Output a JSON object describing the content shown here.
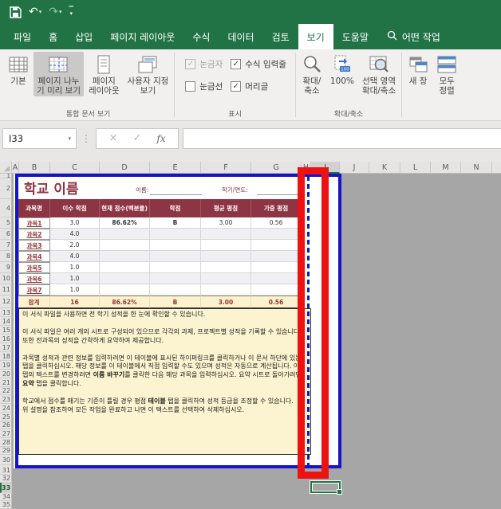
{
  "qat": {
    "items": [
      "save",
      "undo",
      "redo",
      "customize-quick-access-toolbar"
    ]
  },
  "tabs": {
    "items": [
      "파일",
      "홈",
      "삽입",
      "페이지 레이아웃",
      "수식",
      "데이터",
      "검토",
      "보기",
      "도움말"
    ],
    "selected": "보기",
    "search": "어떤 작업"
  },
  "ribbon": {
    "views_group": {
      "label": "통합 문서 보기",
      "buttons": [
        {
          "label1": "기본",
          "label2": ""
        },
        {
          "label1": "페이지 나누",
          "label2": "기 미리 보기"
        },
        {
          "label1": "페이지",
          "label2": "레이아웃"
        },
        {
          "label1": "사용자 지정",
          "label2": "보기"
        }
      ]
    },
    "show_group": {
      "label": "표시",
      "checkboxes": [
        {
          "label": "눈금자"
        },
        {
          "label": "수식 입력줄"
        },
        {
          "label": "눈금선"
        },
        {
          "label": "머리글"
        }
      ]
    },
    "zoom_group": {
      "label": "확대/축소",
      "buttons": [
        {
          "label1": "확대/",
          "label2": "축소"
        },
        {
          "label1": "100%",
          "label2": ""
        },
        {
          "label1": "선택 영역",
          "label2": "확대/축소"
        }
      ]
    },
    "window_group": {
      "buttons": [
        {
          "label1": "새 창",
          "label2": ""
        },
        {
          "label1": "모두",
          "label2": "정렬"
        }
      ]
    }
  },
  "formula_bar": {
    "name_box": "I33",
    "cancel": "×",
    "enter": "✓",
    "fx": "fx"
  },
  "sheet": {
    "columns": [
      "A",
      "B",
      "C",
      "D",
      "E",
      "F",
      "G",
      "H",
      "I",
      "J",
      "K",
      "L",
      "M",
      "N"
    ],
    "rows": [
      "1",
      "2",
      "4",
      "5",
      "6",
      "7",
      "8",
      "9",
      "10",
      "11",
      "12",
      "13",
      "14",
      "15",
      "16",
      "17",
      "18",
      "19",
      "20",
      "21",
      "22",
      "23",
      "24",
      "25",
      "26",
      "27",
      "28",
      "29",
      "30",
      "31",
      "32",
      "33",
      "34",
      "35"
    ],
    "title": "학교 이름",
    "name_label": "이름:",
    "term_label": "학기/연도:",
    "table": {
      "headers": [
        "과목명",
        "이수 학점",
        "현재 점수(백분율)",
        "학점",
        "평균 평점",
        "가중 평점"
      ],
      "rows": [
        {
          "subject": "과목1",
          "credit": "3.0",
          "score": "86.62%",
          "grade": "B",
          "avg": "3.00",
          "weighted": "0.56"
        },
        {
          "subject": "과목2",
          "credit": "4.0",
          "score": "",
          "grade": "",
          "avg": "",
          "weighted": ""
        },
        {
          "subject": "과목3",
          "credit": "2.0",
          "score": "",
          "grade": "",
          "avg": "",
          "weighted": ""
        },
        {
          "subject": "과목4",
          "credit": "4.0",
          "score": "",
          "grade": "",
          "avg": "",
          "weighted": ""
        },
        {
          "subject": "과목5",
          "credit": "1.0",
          "score": "",
          "grade": "",
          "avg": "",
          "weighted": ""
        },
        {
          "subject": "과목6",
          "credit": "1.0",
          "score": "",
          "grade": "",
          "avg": "",
          "weighted": ""
        },
        {
          "subject": "과목7",
          "credit": "1.0",
          "score": "",
          "grade": "",
          "avg": "",
          "weighted": ""
        }
      ],
      "total": {
        "label": "합계",
        "credit": "16",
        "score": "86.62%",
        "grade": "B",
        "avg": "3.00",
        "weighted": "0.56"
      }
    },
    "instructions": {
      "p1": "이 서식 파일을 사용하면 전 학기 성적을 한 눈에 확인할 수 있습니다.",
      "p2": "이 서식 파일은 여러 개의 시트로 구성되어 있으므로 각각의 과제, 프로젝트별 성적을 기록할 수 있습니다.  또한 전과목의 성적을 간략하게 요약하여 제공합니다.",
      "p3a": "과목별 성적과 관련 정보를 입력하려면 이 테이블에 표시된 하이퍼링크를 클릭하거나 이 문서 하단에 있는 탭을 클릭하십시오. 해당 정보를 이 테이블에서 직접 입력할 수도 있으며 성적은 자동으로 계산됩니다. 아래 탭의 텍스트를 변경하려면 ",
      "p3b": "이름 바꾸기",
      "p3c": "를 클릭한 다음 해당 과목을 입력하십시오. 요약 시트로 돌아가려면 ",
      "p3d": "요약",
      "p3e": " 탭을 클릭합니다.",
      "p4a": "학교에서 점수를 매기는 기준이 틀릴 경우 평점 ",
      "p4b": "테이블",
      "p4c": " 탭을 클릭하여 성적 등급을 조정할 수 있습니다.",
      "p5": "위 설명을 참조하여 모든 작업을 완료하고 나면 이 텍스트를 선택하여 삭제하십시오."
    },
    "active_cell": "I33"
  },
  "colors": {
    "accent_green": "#217346",
    "maroon": "#8E3544",
    "annotation_red": "#EE1111",
    "pagebreak_blue": "#1414CC",
    "outside_gray": "#A6A6A6"
  }
}
